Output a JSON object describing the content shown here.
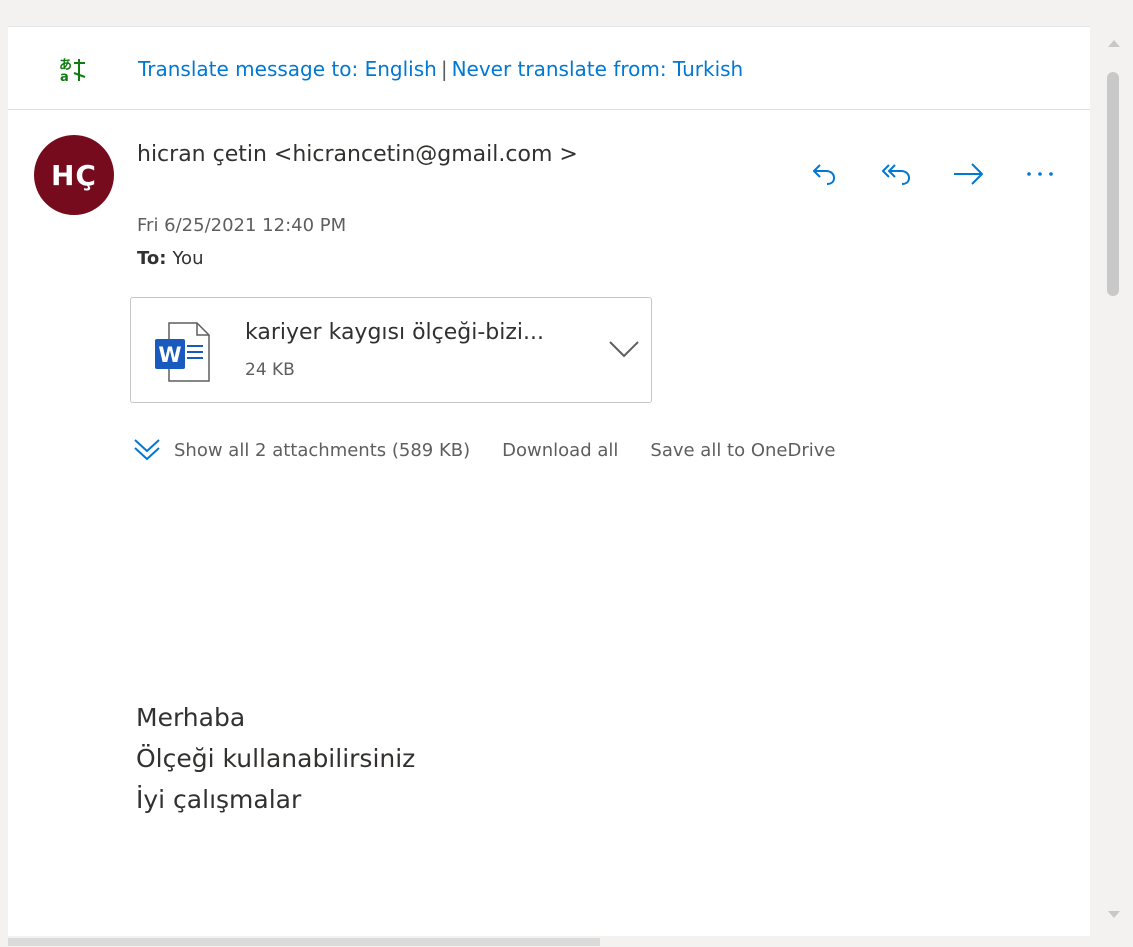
{
  "translate": {
    "prefix": "Translate message to: English",
    "separator": "|",
    "never": "Never translate from: Turkish"
  },
  "message": {
    "avatar_initials": "HÇ",
    "avatar_color": "#750b1c",
    "sender": "hicran çetin <hicrancetin@gmail.com >",
    "date": "Fri 6/25/2021 12:40 PM",
    "to_label": "To:",
    "to_value": "You"
  },
  "actions": [
    {
      "icon": "reply-icon"
    },
    {
      "icon": "reply-all-icon"
    },
    {
      "icon": "forward-icon"
    },
    {
      "icon": "more-actions-icon"
    }
  ],
  "attachment": {
    "icon": "word-document-icon",
    "name": "kariyer kaygısı ölçeği-bizi...",
    "size": "24 KB"
  },
  "attachment_links": {
    "show_all": "Show all 2 attachments (589 KB)",
    "download_all": "Download all",
    "save_onedrive": "Save all to OneDrive"
  },
  "body": {
    "lines": [
      "Merhaba",
      "Ölçeği kullanabilirsiniz",
      "İyi çalışmalar"
    ]
  },
  "colors": {
    "accent": "#0078d4",
    "word_blue": "#185abd"
  }
}
